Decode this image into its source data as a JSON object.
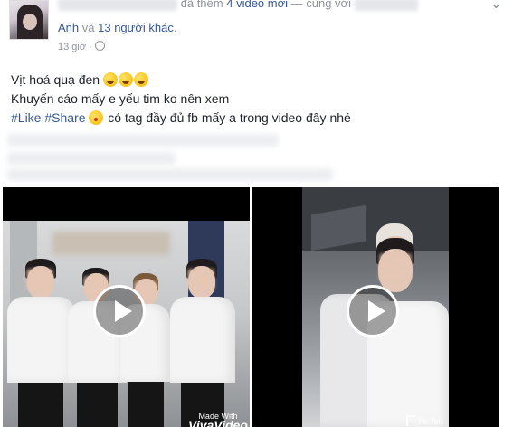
{
  "post": {
    "header": {
      "action_text": "đã thêm",
      "video_count_text": "4 video mới",
      "with_text": "— cùng với",
      "tagged_name": "Anh",
      "and_text": "và",
      "others_text": "13 người khác",
      "time": "13 giờ"
    },
    "body": {
      "line1": "Vịt hoá quạ đen",
      "line2": "Khuyến cáo mấy e yếu tim ko nên xem",
      "hashtag1": "#Like",
      "hashtag2": "#Share",
      "line3_rest": "có tag đầy đủ fb mấy a trong video đây nhé"
    },
    "videos": [
      {
        "watermark_small": "Made With",
        "watermark_brand": "VivaVideo"
      },
      {
        "watermark_brand": "Tik Tok"
      }
    ],
    "icons": {
      "chevron": "chevron-down-icon",
      "privacy": "globe-icon",
      "play": "play-icon"
    }
  }
}
